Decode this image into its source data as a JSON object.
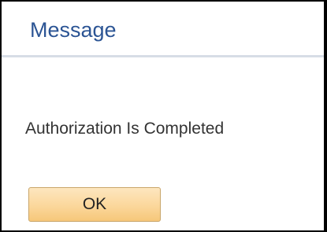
{
  "dialog": {
    "title": "Message",
    "message": "Authorization Is Completed",
    "ok_label": "OK"
  },
  "colors": {
    "title_text": "#2b5494",
    "divider": "#d7dde6",
    "button_top": "#fde6bf",
    "button_bottom": "#f6c77a",
    "button_border": "#c9a66b"
  }
}
